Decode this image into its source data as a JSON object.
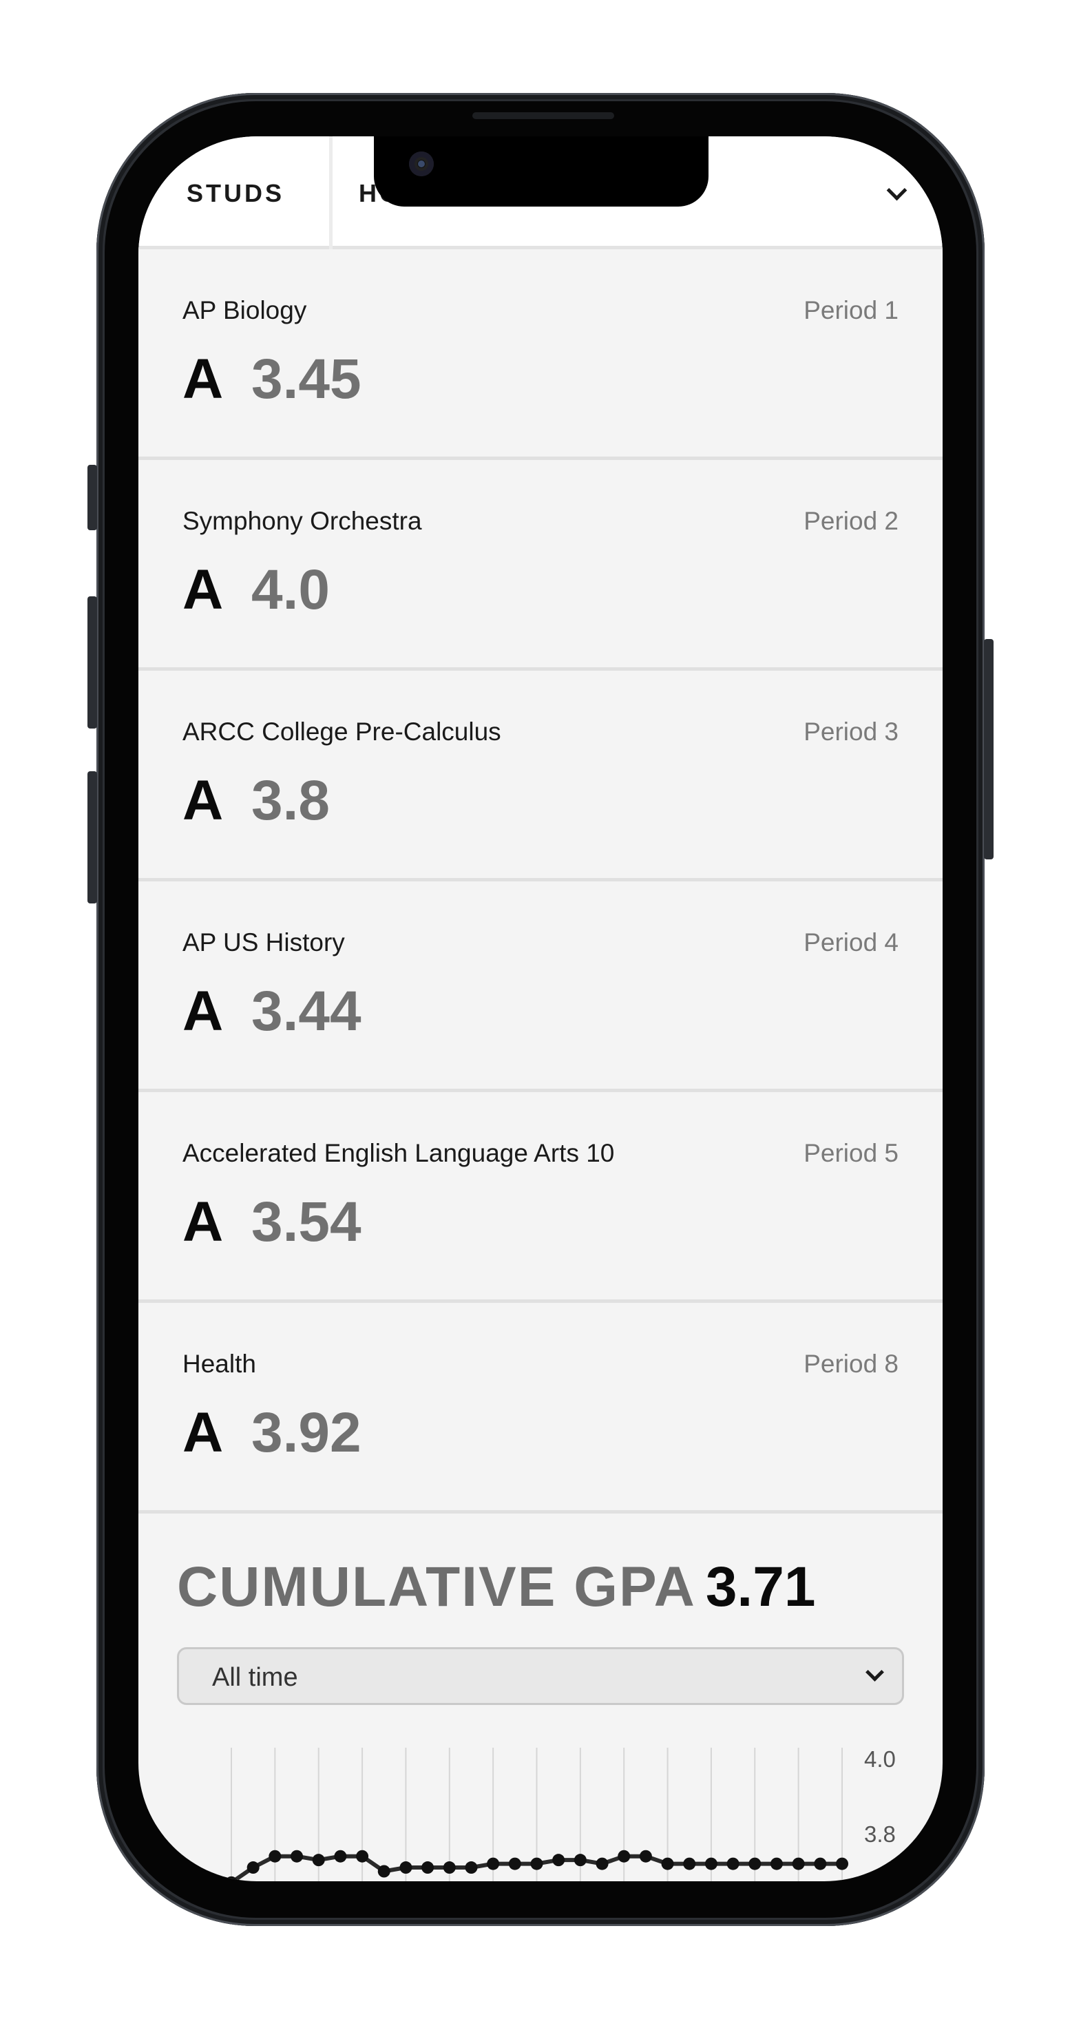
{
  "header": {
    "tabs": [
      {
        "label": "STUDS"
      },
      {
        "label": "HO"
      }
    ],
    "menu_icon": "chevron-down-icon"
  },
  "classes": [
    {
      "name": "AP Biology",
      "period": "Period 1",
      "letter": "A",
      "score": "3.45"
    },
    {
      "name": "Symphony Orchestra",
      "period": "Period 2",
      "letter": "A",
      "score": "4.0"
    },
    {
      "name": "ARCC College Pre-Calculus",
      "period": "Period 3",
      "letter": "A",
      "score": "3.8"
    },
    {
      "name": "AP US History",
      "period": "Period 4",
      "letter": "A",
      "score": "3.44"
    },
    {
      "name": "Accelerated English Language Arts 10",
      "period": "Period 5",
      "letter": "A",
      "score": "3.54"
    },
    {
      "name": "Health",
      "period": "Period 8",
      "letter": "A",
      "score": "3.92"
    }
  ],
  "gpa": {
    "label": "CUMULATIVE GPA",
    "value": "3.71",
    "range_select": {
      "selected": "All time"
    }
  },
  "chart_data": {
    "type": "line",
    "y_ticks": [
      "4.0",
      "3.8"
    ],
    "ylim": [
      3.8,
      4.0
    ],
    "grid": true,
    "series": [
      {
        "values": [
          3.67,
          3.71,
          3.74,
          3.74,
          3.73,
          3.74,
          3.74,
          3.7,
          3.71,
          3.71,
          3.71,
          3.71,
          3.72,
          3.72,
          3.72,
          3.73,
          3.73,
          3.72,
          3.74,
          3.74,
          3.72,
          3.72,
          3.72,
          3.72,
          3.72,
          3.72,
          3.72,
          3.72,
          3.72
        ]
      }
    ]
  },
  "colors": {
    "background": "#f4f4f4",
    "header": "#ffffff",
    "score_gray": "#717171",
    "text_dark": "#0a0a0a",
    "line": "#2a2a2a"
  }
}
